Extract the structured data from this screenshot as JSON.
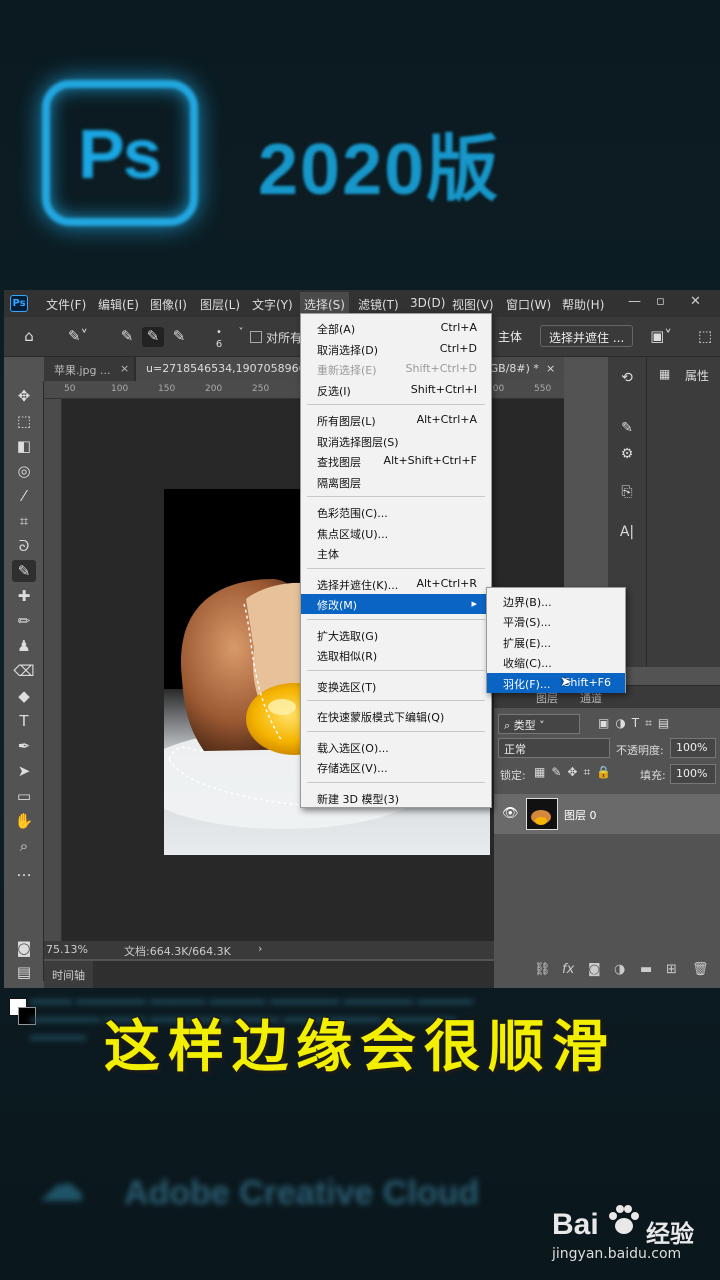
{
  "banner": {
    "logo_text": "Ps",
    "title": "2020版"
  },
  "menubar": {
    "items": [
      "文件(F)",
      "编辑(E)",
      "图像(I)",
      "图层(L)",
      "文字(Y)",
      "选择(S)",
      "滤镜(T)",
      "3D(D)",
      "视图(V)",
      "窗口(W)",
      "帮助(H)"
    ],
    "active": "选择(S)"
  },
  "options": {
    "size_value": "6",
    "align_label": "对所有",
    "subject_button": "主体",
    "select_mask_button": "选择并遮住 ..."
  },
  "tabs": [
    {
      "label": "苹果.jpg ...",
      "close": "×"
    },
    {
      "label": "u=2718546534,1907058966",
      "suffix": "RGB/8#) *",
      "close": "×"
    }
  ],
  "ruler": {
    "ticks": [
      "50",
      "100",
      "150",
      "200",
      "250",
      "300",
      "350",
      "400",
      "450",
      "500",
      "550"
    ]
  },
  "status": {
    "zoom": "75.13%",
    "doc": "文档:664.3K/664.3K",
    "arrow": "›"
  },
  "timeline": {
    "label": "时间轴"
  },
  "properties": {
    "label": "属性"
  },
  "layers": {
    "tabs": [
      "图层",
      "通道"
    ],
    "filter_kind": "类型",
    "blend_mode": "正常",
    "opacity_label": "不透明度:",
    "opacity_value": "100%",
    "lock_label": "锁定:",
    "fill_label": "填充:",
    "fill_value": "100%",
    "layer_name": "图层 0"
  },
  "select_menu": {
    "groups": [
      [
        {
          "label": "全部(A)",
          "shortcut": "Ctrl+A"
        },
        {
          "label": "取消选择(D)",
          "shortcut": "Ctrl+D"
        },
        {
          "label": "重新选择(E)",
          "shortcut": "Shift+Ctrl+D",
          "disabled": true
        },
        {
          "label": "反选(I)",
          "shortcut": "Shift+Ctrl+I"
        }
      ],
      [
        {
          "label": "所有图层(L)",
          "shortcut": "Alt+Ctrl+A"
        },
        {
          "label": "取消选择图层(S)",
          "shortcut": ""
        },
        {
          "label": "查找图层",
          "shortcut": "Alt+Shift+Ctrl+F"
        },
        {
          "label": "隔离图层",
          "shortcut": ""
        }
      ],
      [
        {
          "label": "色彩范围(C)...",
          "shortcut": ""
        },
        {
          "label": "焦点区域(U)...",
          "shortcut": ""
        },
        {
          "label": "主体",
          "shortcut": ""
        }
      ],
      [
        {
          "label": "选择并遮住(K)...",
          "shortcut": "Alt+Ctrl+R"
        },
        {
          "label": "修改(M)",
          "shortcut": "▸",
          "highlighted": true
        }
      ],
      [
        {
          "label": "扩大选取(G)",
          "shortcut": ""
        },
        {
          "label": "选取相似(R)",
          "shortcut": ""
        }
      ],
      [
        {
          "label": "变换选区(T)",
          "shortcut": ""
        }
      ],
      [
        {
          "label": "在快速蒙版模式下编辑(Q)",
          "shortcut": ""
        }
      ],
      [
        {
          "label": "载入选区(O)...",
          "shortcut": ""
        },
        {
          "label": "存储选区(V)...",
          "shortcut": ""
        }
      ],
      [
        {
          "label": "新建 3D 模型(3)",
          "shortcut": ""
        }
      ]
    ]
  },
  "modify_menu": {
    "items": [
      {
        "label": "边界(B)...",
        "shortcut": ""
      },
      {
        "label": "平滑(S)...",
        "shortcut": ""
      },
      {
        "label": "扩展(E)...",
        "shortcut": ""
      },
      {
        "label": "收缩(C)...",
        "shortcut": ""
      },
      {
        "label": "羽化(F)...",
        "shortcut": "Shift+F6",
        "highlighted": true
      }
    ]
  },
  "caption": "这样边缘会很顺滑",
  "ghost": {
    "brand": "Adobe Creative Cloud"
  },
  "watermark": {
    "bai": "Bai",
    "jingyan": "经验",
    "url": "jingyan.baidu.com"
  },
  "colors": {
    "accent": "#0a64c4",
    "caption": "#f2ef00",
    "ps_blue": "#31a8ff"
  }
}
